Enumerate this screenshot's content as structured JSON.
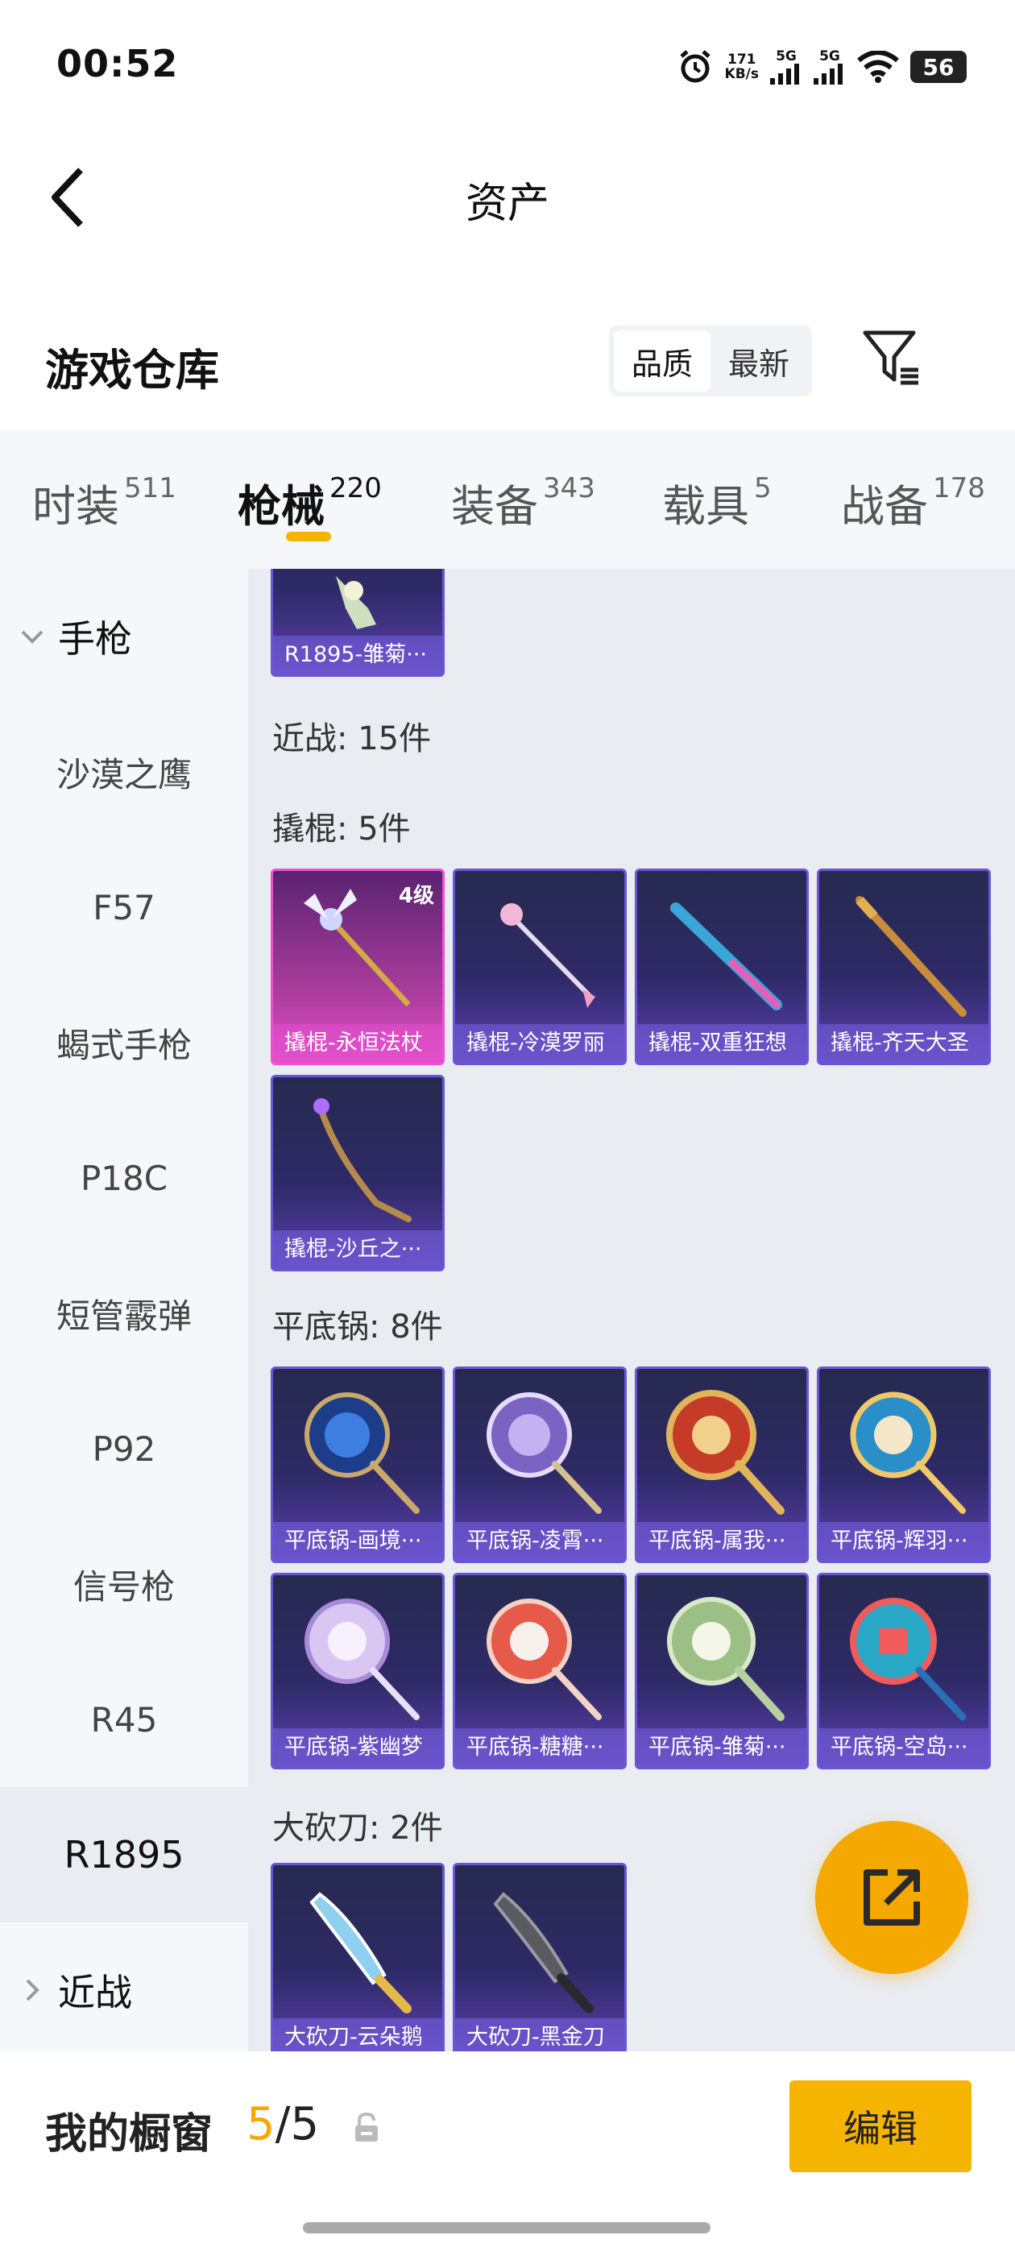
{
  "status_bar": {
    "time": "00:52",
    "net_speed_value": "171",
    "net_speed_unit": "KB/s",
    "sim1": "5G",
    "sim2": "5G",
    "battery": "56"
  },
  "header": {
    "title": "资产"
  },
  "section": {
    "title": "游戏仓库",
    "sort_options": [
      "品质",
      "最新"
    ],
    "sort_active": "品质"
  },
  "tabs": [
    {
      "label": "时装",
      "count": "511"
    },
    {
      "label": "枪械",
      "count": "220",
      "active": true
    },
    {
      "label": "装备",
      "count": "343"
    },
    {
      "label": "载具",
      "count": "5"
    },
    {
      "label": "战备",
      "count": "178"
    }
  ],
  "sidebar": {
    "items": [
      {
        "label": "手枪"
      },
      {
        "label": "沙漠之鹰"
      },
      {
        "label": "F57"
      },
      {
        "label": "蝎式手枪"
      },
      {
        "label": "P18C"
      },
      {
        "label": "短管霰弹"
      },
      {
        "label": "P92"
      },
      {
        "label": "信号枪"
      },
      {
        "label": "R45"
      },
      {
        "label": "R1895",
        "active": true
      },
      {
        "label": "近战"
      }
    ]
  },
  "content": {
    "top_partial_card": "R1895-雏菊···",
    "melee_header": "近战: 15件",
    "crowbar": {
      "header": "撬棍: 5件",
      "items": [
        {
          "label": "撬棍-永恒法杖",
          "badge": "4级"
        },
        {
          "label": "撬棍-冷漠罗丽"
        },
        {
          "label": "撬棍-双重狂想"
        },
        {
          "label": "撬棍-齐天大圣"
        },
        {
          "label": "撬棍-沙丘之···"
        }
      ]
    },
    "pan": {
      "header": "平底锅: 8件",
      "items": [
        {
          "label": "平底锅-画境···"
        },
        {
          "label": "平底锅-凌霄···"
        },
        {
          "label": "平底锅-属我···"
        },
        {
          "label": "平底锅-辉羽···"
        },
        {
          "label": "平底锅-紫幽梦"
        },
        {
          "label": "平底锅-糖糖···"
        },
        {
          "label": "平底锅-雏菊···"
        },
        {
          "label": "平底锅-空岛···"
        }
      ]
    },
    "machete": {
      "header": "大砍刀: 2件",
      "items": [
        {
          "label": "大砍刀-云朵鹅"
        },
        {
          "label": "大砍刀-黑金刀"
        }
      ]
    }
  },
  "bottom": {
    "showcase_label": "我的橱窗",
    "showcase_current": "5",
    "showcase_total": "/5",
    "edit_label": "编辑"
  },
  "colors": {
    "accent": "#f5b400",
    "card_bg": "#2e2a66",
    "card_border": "#6a55d6",
    "rare_border": "#f04fd6"
  }
}
